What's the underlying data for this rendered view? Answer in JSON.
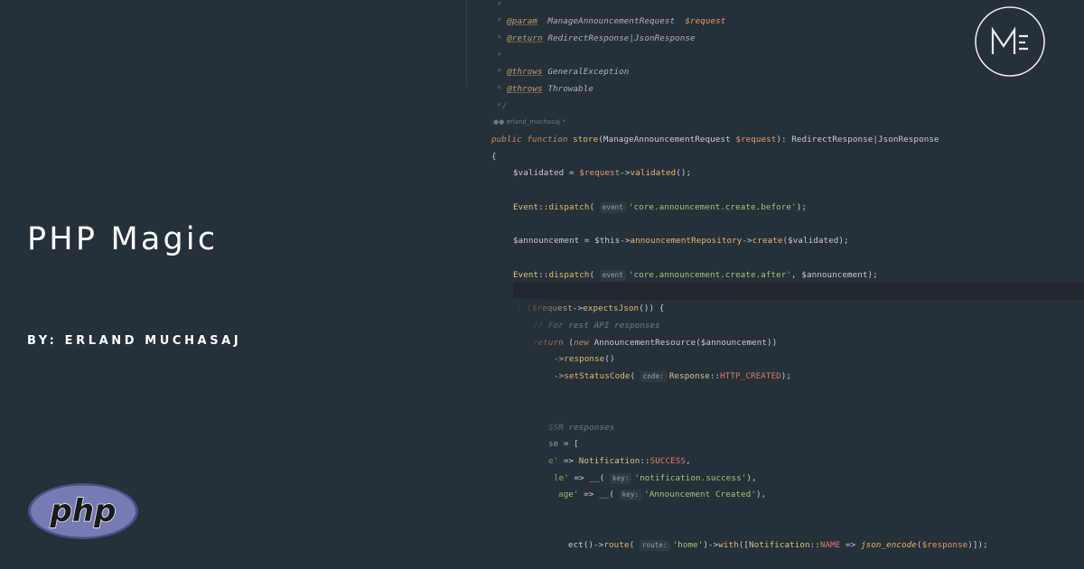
{
  "hero": {
    "title": "PHP Magic",
    "byline": "BY: ERLAND MUCHASAJ"
  },
  "logos": {
    "php_logo_text": "php",
    "brand_logo_icon": "me-monogram-icon"
  },
  "code": {
    "author_hint": "erland_muchasaj *",
    "lines": [
      "*",
      "* @param  ManageAnnouncementRequest  $request",
      "* @return RedirectResponse|JsonResponse",
      "*",
      "* @throws GeneralException",
      "* @throws Throwable",
      "*/",
      "public function store(ManageAnnouncementRequest $request): RedirectResponse|JsonResponse",
      "{",
      "$validated = $request->validated();",
      "Event::dispatch( event 'core.announcement.create.before');",
      "$announcement = $this->announcementRepository->create($validated);",
      "Event::dispatch( event 'core.announcement.create.after', $announcement);",
      "f ($request->expectsJson()) {",
      "// For rest API responses",
      "return (new AnnouncementResource($announcement))",
      "->response()",
      "->setStatusCode( code: Response::HTTP_CREATED);",
      "SSR responses",
      "se = [",
      "e' => Notification::SUCCESS,",
      "le' => __( key: 'notification.success'),",
      "age' => __( key: 'Announcement Created'),",
      "ect()->route( route: 'home')->with([Notification::NAME => json_encode($response)]);"
    ]
  },
  "colors": {
    "background": "#263038",
    "title": "#ffffff",
    "php_logo_fill": "#777bb3"
  }
}
